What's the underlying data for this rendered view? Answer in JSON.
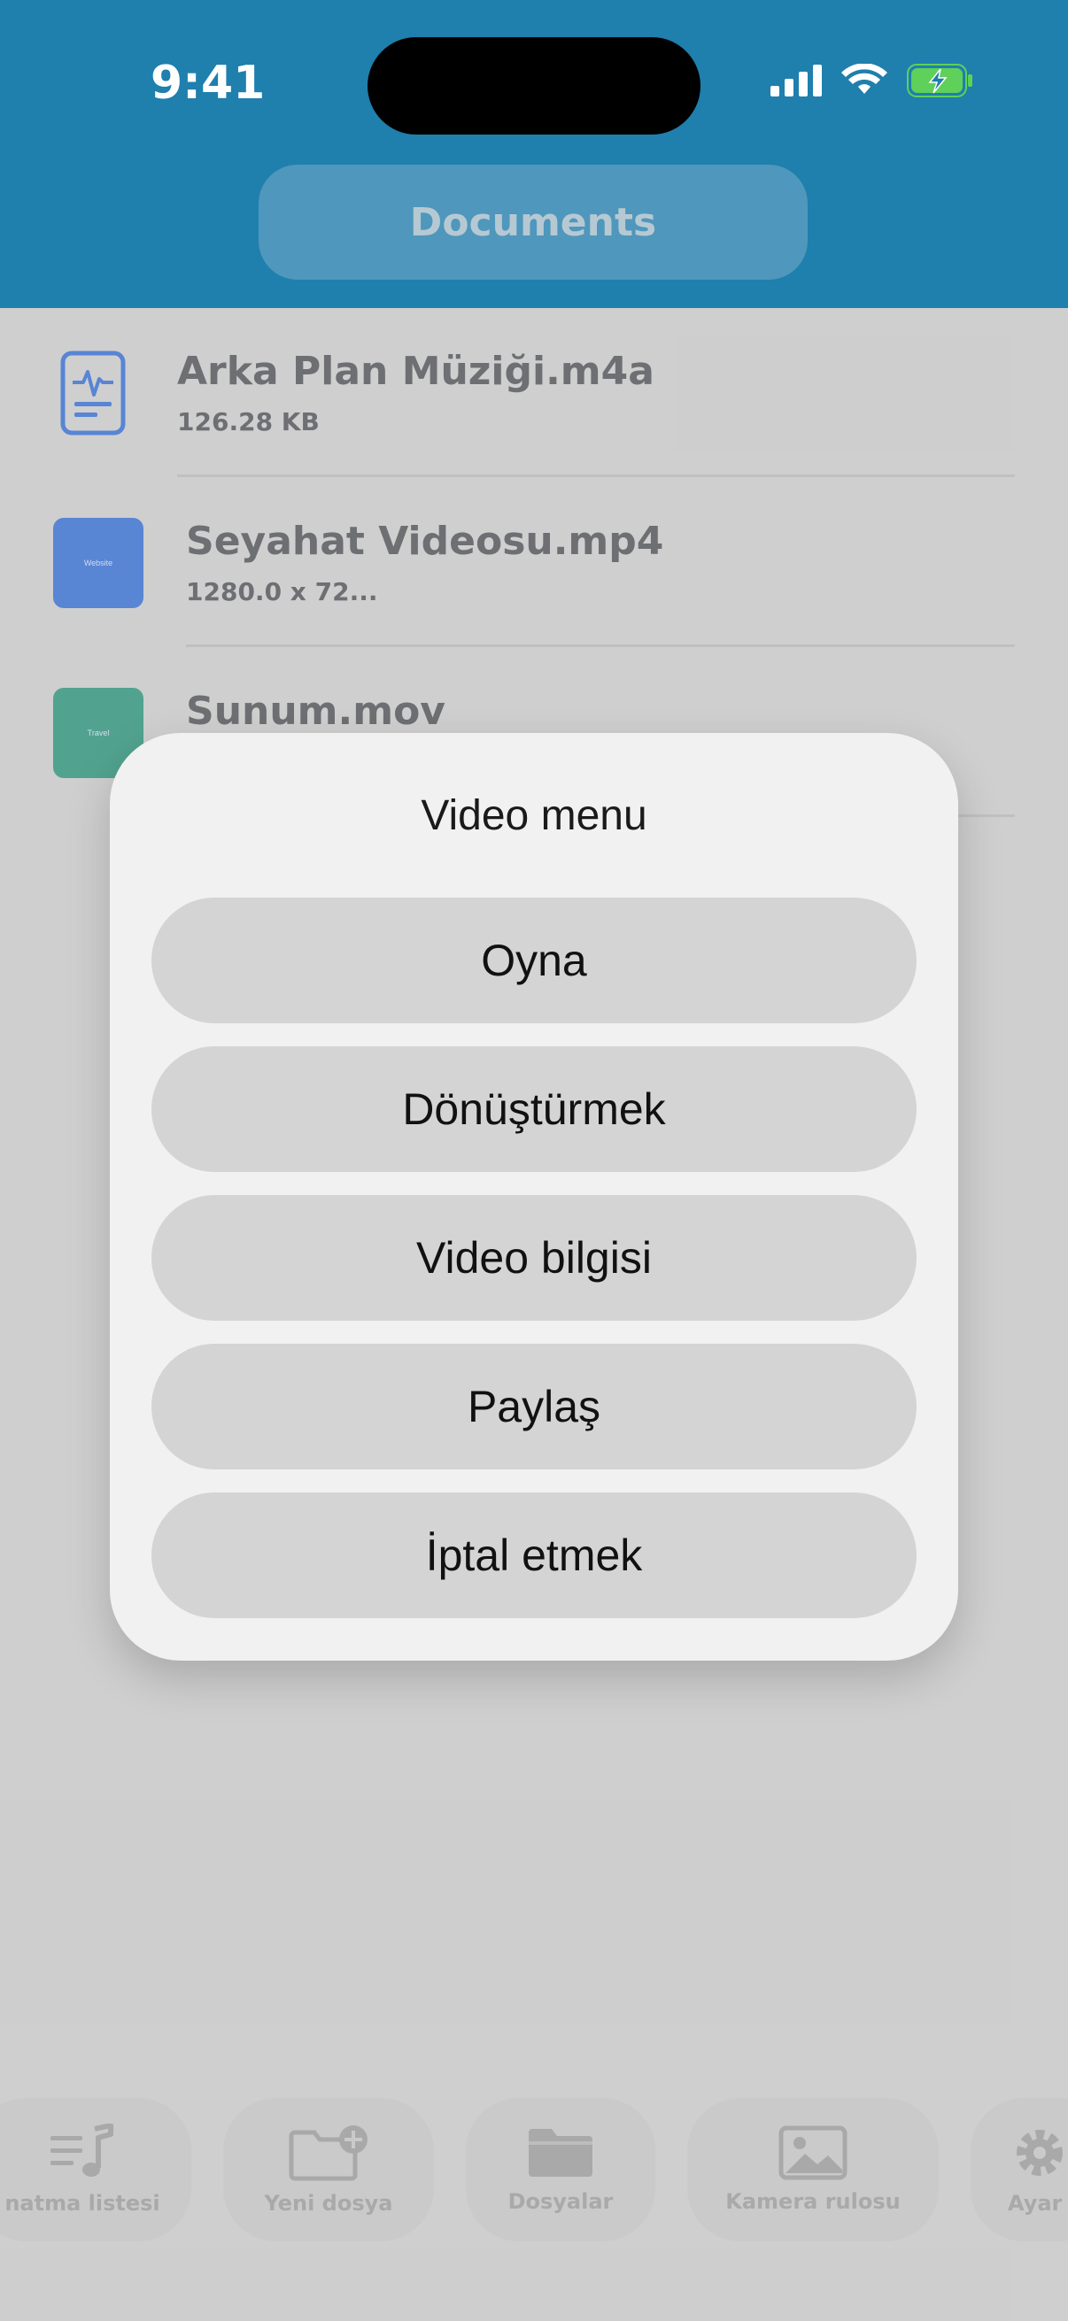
{
  "status_bar": {
    "time": "9:41"
  },
  "header": {
    "title": "Documents"
  },
  "files": [
    {
      "name": "Arka Plan Müziği.m4a",
      "meta": "126.28 KB",
      "icon": "audio-document-icon"
    },
    {
      "name": "Seyahat Videosu.mp4",
      "meta": "1280.0 x 72...",
      "thumb_text": "Website",
      "thumb_color": "#1a5fd8"
    },
    {
      "name": "Sunum.mov",
      "meta": "",
      "thumb_text": "Travel",
      "thumb_color": "#0e8d6d"
    }
  ],
  "dialog": {
    "title": "Video menu",
    "buttons": [
      "Oyna",
      "Dönüştürmek",
      "Video bilgisi",
      "Paylaş",
      "İptal etmek"
    ]
  },
  "tabbar": {
    "items": [
      {
        "label": "natma listesi",
        "icon": "playlist-icon"
      },
      {
        "label": "Yeni dosya",
        "icon": "new-folder-icon"
      },
      {
        "label": "Dosyalar",
        "icon": "folder-icon"
      },
      {
        "label": "Kamera rulosu",
        "icon": "photo-icon"
      },
      {
        "label": "Ayar",
        "icon": "gear-icon"
      }
    ]
  },
  "colors": {
    "header": "#1f7fad",
    "accent": "#1a5fd8",
    "battery": "#5fd05a"
  }
}
